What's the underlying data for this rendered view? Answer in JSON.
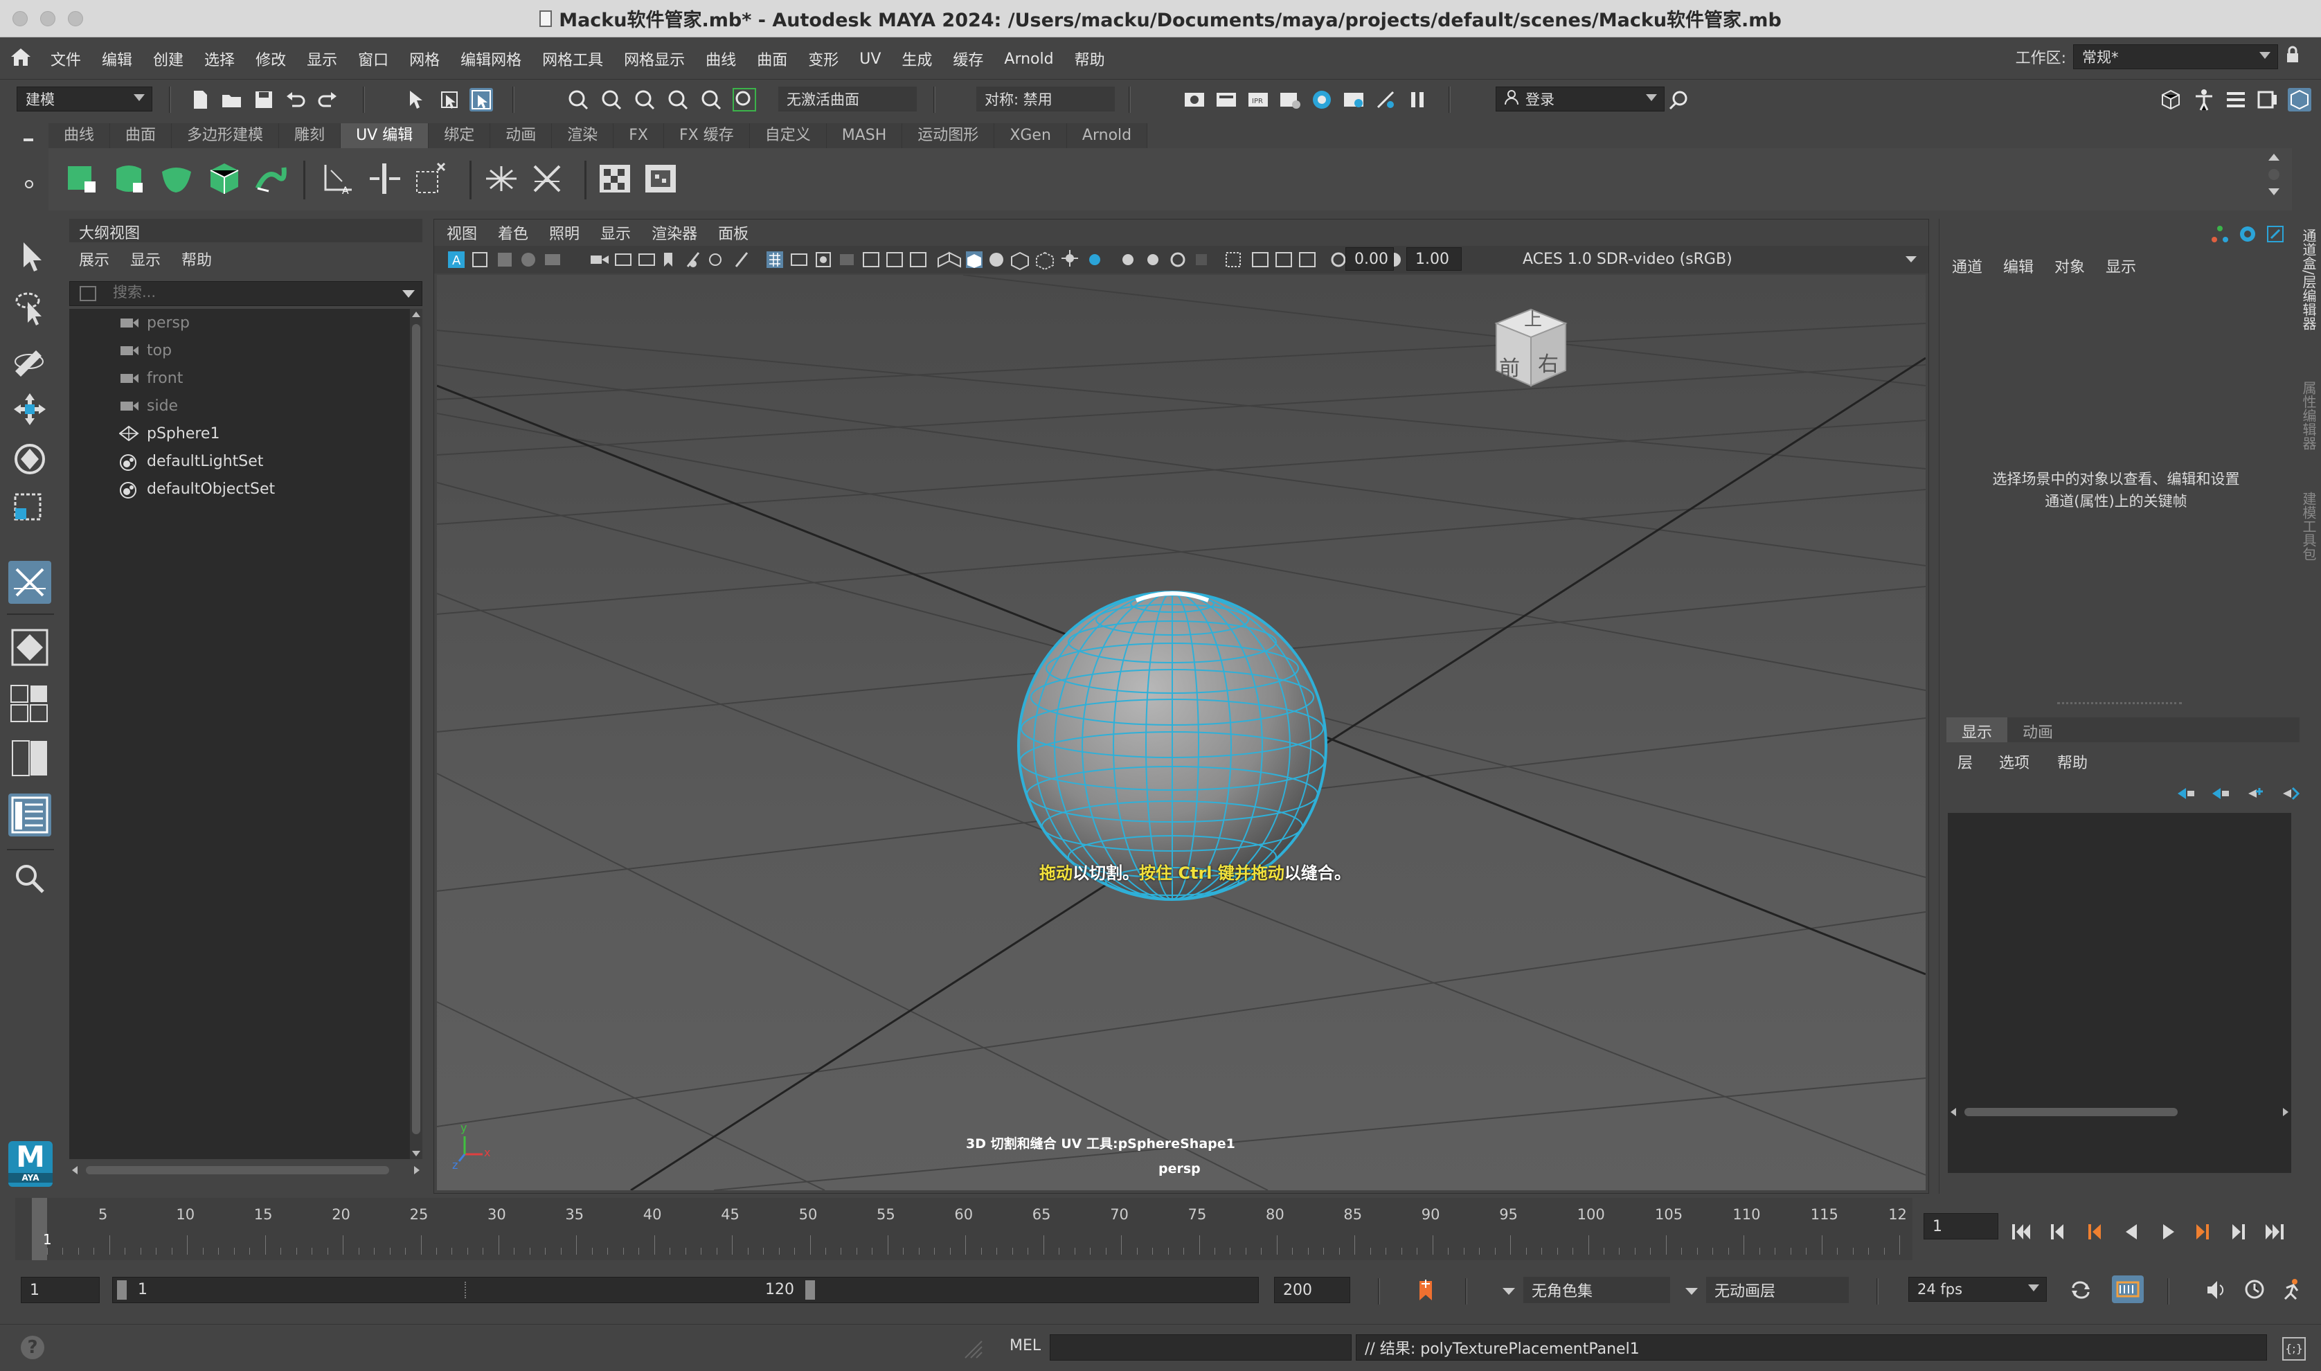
{
  "window": {
    "title": "Macku软件管家.mb* - Autodesk MAYA 2024: /Users/macku/Documents/maya/projects/default/scenes/Macku软件管家.mb"
  },
  "menubar": {
    "items": [
      "文件",
      "编辑",
      "创建",
      "选择",
      "修改",
      "显示",
      "窗口",
      "网格",
      "编辑网格",
      "网格工具",
      "网格显示",
      "曲线",
      "曲面",
      "变形",
      "UV",
      "生成",
      "缓存",
      "Arnold",
      "帮助"
    ],
    "workspace_label": "工作区:",
    "workspace_value": "常规*"
  },
  "statusline": {
    "mode": "建模",
    "live_surface": "无激活曲面",
    "symmetry": "对称: 禁用",
    "login": "登录"
  },
  "shelf": {
    "tabs": [
      "曲线",
      "曲面",
      "多边形建模",
      "雕刻",
      "UV 编辑",
      "绑定",
      "动画",
      "渲染",
      "FX",
      "FX 缓存",
      "自定义",
      "MASH",
      "运动图形",
      "XGen",
      "Arnold"
    ],
    "active_tab": "UV 编辑"
  },
  "outliner": {
    "title": "大纲视图",
    "menu": [
      "展示",
      "显示",
      "帮助"
    ],
    "search_placeholder": "搜索...",
    "items": [
      {
        "label": "persp",
        "icon": "camera-icon",
        "dim": true
      },
      {
        "label": "top",
        "icon": "camera-icon",
        "dim": true
      },
      {
        "label": "front",
        "icon": "camera-icon",
        "dim": true
      },
      {
        "label": "side",
        "icon": "camera-icon",
        "dim": true
      },
      {
        "label": "pSphere1",
        "icon": "mesh-icon",
        "dim": false
      },
      {
        "label": "defaultLightSet",
        "icon": "set-icon",
        "dim": false
      },
      {
        "label": "defaultObjectSet",
        "icon": "set-icon",
        "dim": false
      }
    ]
  },
  "viewport": {
    "menu": [
      "视图",
      "着色",
      "照明",
      "显示",
      "渲染器",
      "面板"
    ],
    "exposure": "0.00",
    "gamma": "1.00",
    "colorspace": "ACES 1.0 SDR-video (sRGB)",
    "viewcube": {
      "top": "上",
      "front": "前",
      "right": "右"
    },
    "hint_parts": [
      {
        "text": "拖动",
        "hl": true
      },
      {
        "text": "以切割。",
        "hl": false
      },
      {
        "text": "按住 Ctrl 键并拖动",
        "hl": true
      },
      {
        "text": "以缝合。",
        "hl": false
      }
    ],
    "tool_label": "3D 切割和缝合 UV 工具:pSphereShape1",
    "camera_label": "persp",
    "axis": {
      "x": "x",
      "y": "y",
      "z": "z"
    }
  },
  "channelbox": {
    "menu": [
      "通道",
      "编辑",
      "对象",
      "显示"
    ],
    "message_line1": "选择场景中的对象以查看、编辑和设置",
    "message_line2": "通道(属性)上的关键帧",
    "side_tabs": [
      "通道盒/层编辑器",
      "属性编辑器",
      "建模工具包"
    ],
    "layer_tabs": [
      "显示",
      "动画"
    ],
    "layer_menu": [
      "层",
      "选项",
      "帮助"
    ]
  },
  "timeline": {
    "ticks": [
      "5",
      "10",
      "15",
      "20",
      "25",
      "30",
      "35",
      "40",
      "45",
      "50",
      "55",
      "60",
      "65",
      "70",
      "75",
      "80",
      "85",
      "90",
      "95",
      "100",
      "105",
      "110",
      "115",
      "12"
    ],
    "current_marker": "1",
    "current_frame": "1"
  },
  "range": {
    "start": "1",
    "range_start": "1",
    "range_end": "120",
    "end": "200",
    "character_set": "无角色集",
    "anim_layer": "无动画层",
    "fps": "24 fps"
  },
  "commandline": {
    "lang": "MEL",
    "result": "// 结果: polyTexturePlacementPanel1"
  },
  "logo": {
    "text": "AYA"
  },
  "colors": {
    "accent": "#5ea9d6",
    "wire": "#2fb0d8",
    "hint_highlight": "#f2e13c",
    "active_tool": "#5e87a6"
  }
}
